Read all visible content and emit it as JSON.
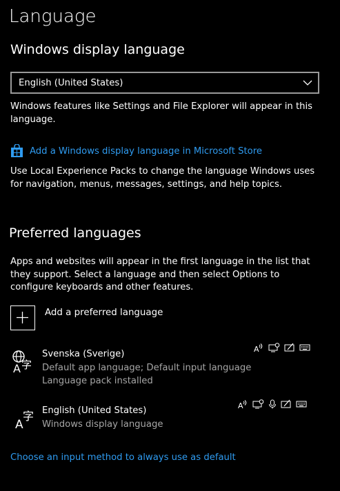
{
  "page": {
    "title": "Language"
  },
  "display_language": {
    "heading": "Windows display language",
    "dropdown_value": "English (United States)",
    "description": "Windows features like Settings and File Explorer will appear in this language.",
    "store_link": "Add a Windows display language in Microsoft Store",
    "packs_description": "Use Local Experience Packs to change the language Windows uses for navigation, menus, messages, settings, and help topics."
  },
  "preferred": {
    "heading": "Preferred languages",
    "description": "Apps and websites will appear in the first language in the list that they support. Select a language and then select Options to configure keyboards and other features.",
    "add_label": "Add a preferred language",
    "languages": [
      {
        "name": "Svenska (Sverige)",
        "line1": "Default app language; Default input language",
        "line2": "Language pack installed",
        "features": [
          "text-to-speech-icon",
          "display-language-icon",
          "handwriting-icon",
          "keyboard-icon"
        ]
      },
      {
        "name": "English (United States)",
        "line1": "Windows display language",
        "features": [
          "text-to-speech-icon",
          "display-language-icon",
          "microphone-icon",
          "handwriting-icon",
          "keyboard-icon"
        ]
      }
    ]
  },
  "footer": {
    "input_method_link": "Choose an input method to always use as default"
  },
  "colors": {
    "background": "#000000",
    "text": "#ffffff",
    "secondary_text": "#a6a6a6",
    "link": "#2f9bf0",
    "border": "#9a9a9a"
  }
}
